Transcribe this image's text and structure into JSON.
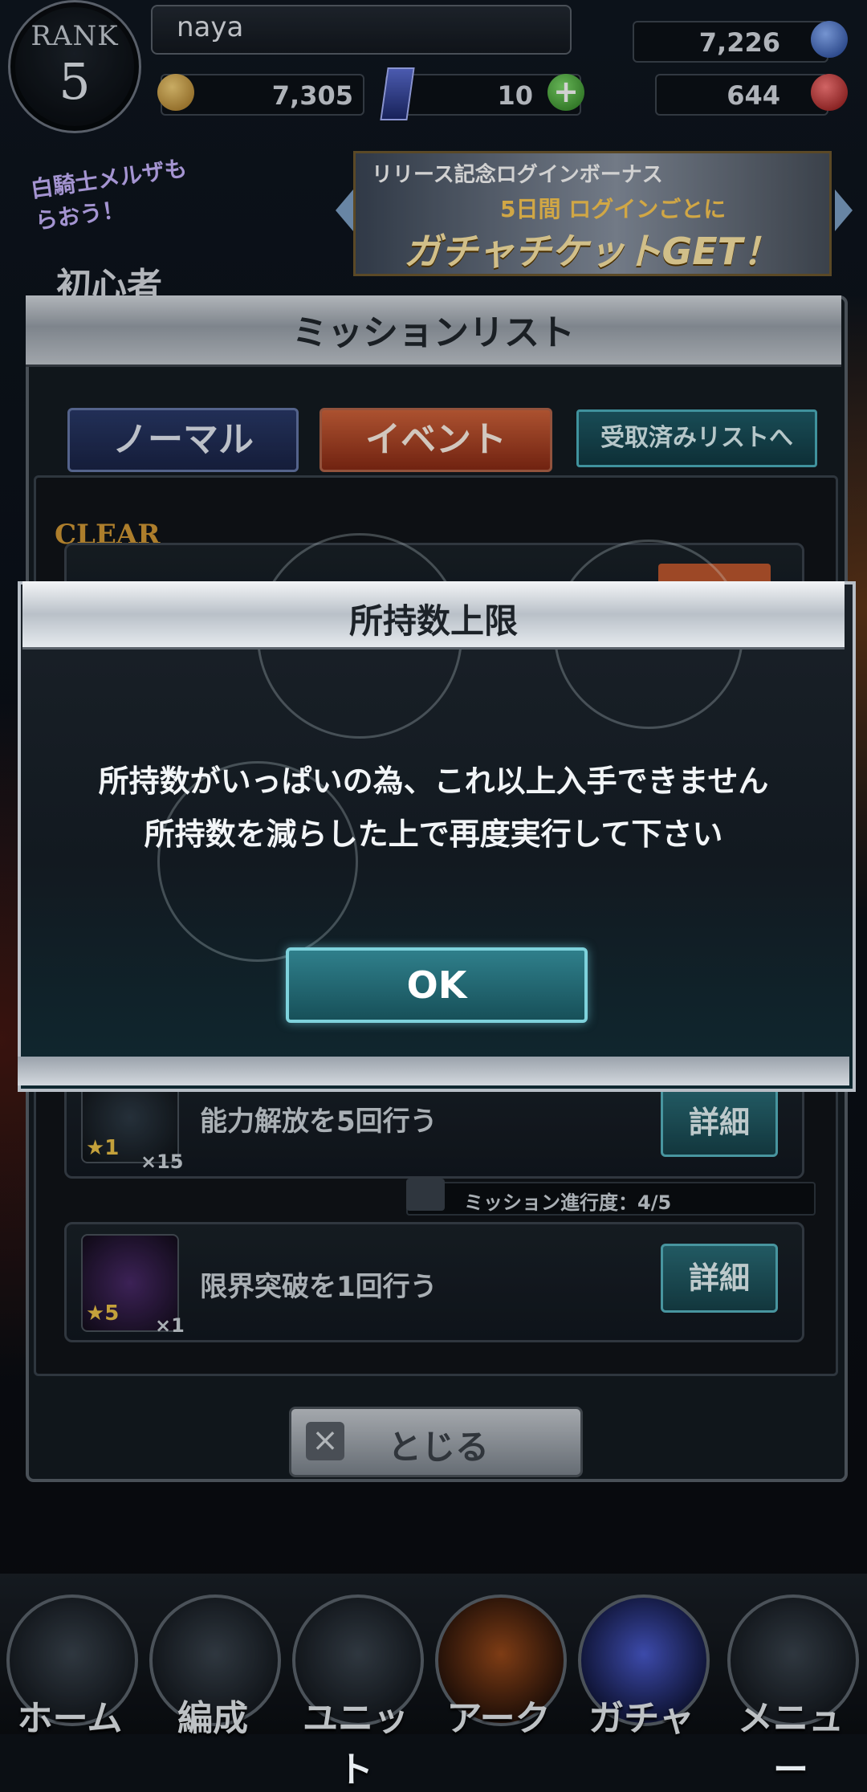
{
  "header": {
    "rank_label": "RANK",
    "rank_value": "5",
    "player_name": "naya",
    "gold": "7,305",
    "crystals": "10",
    "stamina_top": "7,226",
    "stamina_red": "644"
  },
  "promo": {
    "left_text": "白騎士メルザもらおう！",
    "left_sub": "初心者",
    "banner_line1": "リリース記念ログインボーナス",
    "banner_line2": "5日間 ログインごとに",
    "banner_line3": "ガチャチケットGET！"
  },
  "mission_panel": {
    "title": "ミッションリスト",
    "tabs": [
      {
        "label": "ノーマル"
      },
      {
        "label": "イベント"
      },
      {
        "label": "受取済みリストへ"
      }
    ],
    "clear_label": "CLEAR",
    "rows": [
      {
        "text": "能力解放を5回行う",
        "star": "★1",
        "qty": "×15",
        "detail": "詳細",
        "progress": "ミッション進行度：4/5"
      },
      {
        "text": "限界突破を1回行う",
        "star": "★5",
        "qty": "×1",
        "detail": "詳細"
      }
    ],
    "close_icon": "×",
    "close_label": "とじる"
  },
  "dialog": {
    "title": "所持数上限",
    "line1": "所持数がいっぱいの為、これ以上入手できません",
    "line2": "所持数を減らした上で再度実行して下さい",
    "ok": "OK"
  },
  "nav": [
    {
      "label": "ホーム"
    },
    {
      "label": "編成"
    },
    {
      "label": "ユニット"
    },
    {
      "label": "アーク"
    },
    {
      "label": "ガチャ"
    },
    {
      "label": "メニュー"
    }
  ]
}
